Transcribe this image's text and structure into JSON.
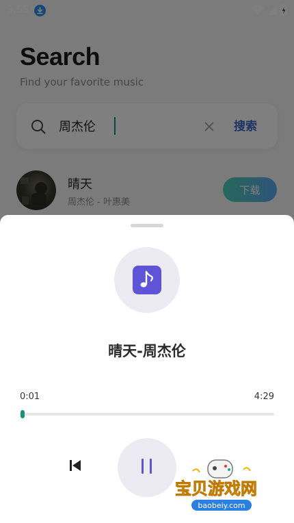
{
  "status_bar": {
    "time": "9:55",
    "download_icon": "download-icon",
    "wifi_icon": "wifi-icon",
    "signal_icon": "signal-icon",
    "battery_icon": "battery-charging-icon"
  },
  "header": {
    "title": "Search",
    "subtitle": "Find your favorite music"
  },
  "search": {
    "value": "周杰伦",
    "button_label": "搜索",
    "search_icon": "search-icon",
    "clear_icon": "close-icon"
  },
  "results": [
    {
      "title": "晴天",
      "subtitle": "周杰伦 - 叶惠美",
      "action_label": "下载"
    }
  ],
  "player": {
    "cover_icon": "music-note-icon",
    "song_title": "晴天-周杰伦",
    "current_time": "0:01",
    "total_time": "4:29",
    "progress": 0.004,
    "state": "playing",
    "prev_icon": "skip-previous-icon",
    "pause_icon": "pause-icon",
    "accent_color": "#5f54d8",
    "progress_color": "#1fa08a"
  },
  "watermark": {
    "text": "宝贝游戏网",
    "url": "baobeiy.com"
  }
}
